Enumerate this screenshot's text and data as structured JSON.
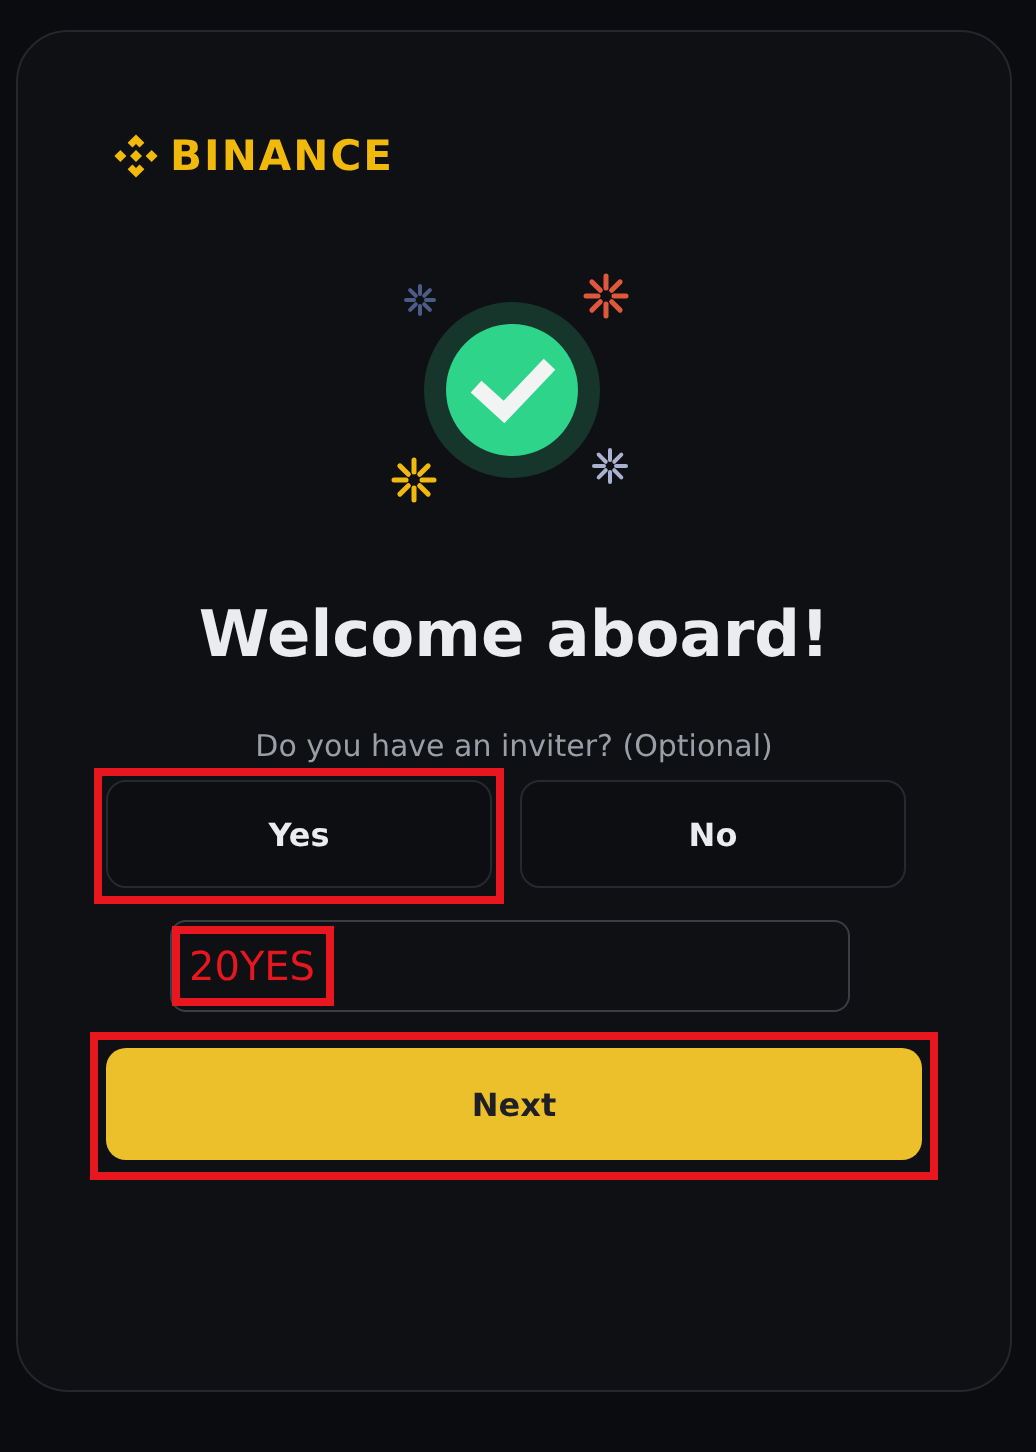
{
  "logo": {
    "text": "BINANCE"
  },
  "title": "Welcome aboard!",
  "question": "Do you have an inviter? (Optional)",
  "options": [
    {
      "label": "Yes",
      "highlighted": true
    },
    {
      "label": "No",
      "highlighted": false
    }
  ],
  "referral_field": {
    "value": "20YES",
    "highlighted": true
  },
  "next_button": {
    "label": "Next",
    "highlighted": true
  }
}
